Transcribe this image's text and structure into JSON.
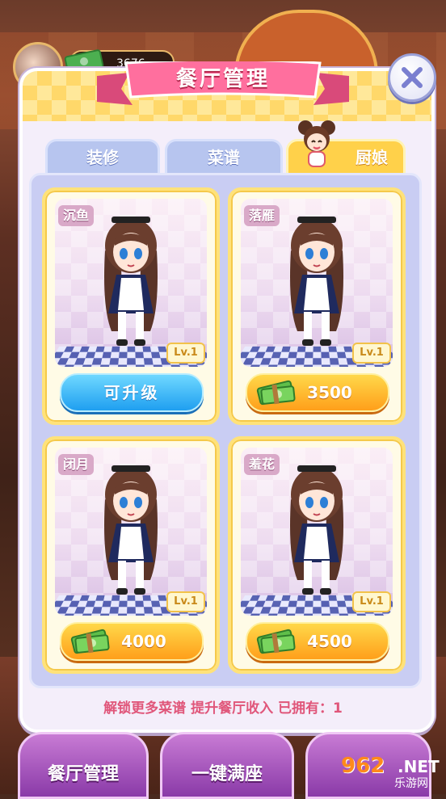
{
  "top_bar": {
    "money": "3676"
  },
  "modal": {
    "title": "餐厅管理"
  },
  "tabs": [
    {
      "label": "装修",
      "active": false
    },
    {
      "label": "菜谱",
      "active": false
    },
    {
      "label": "厨娘",
      "active": true
    }
  ],
  "cards": [
    {
      "name": "沉鱼",
      "level": "Lv.1",
      "button": "可升级",
      "button_type": "upgrade"
    },
    {
      "name": "落雁",
      "level": "Lv.1",
      "button": "3500",
      "button_type": "cost"
    },
    {
      "name": "闭月",
      "level": "Lv.1",
      "button": "4000",
      "button_type": "cost"
    },
    {
      "name": "羞花",
      "level": "Lv.1",
      "button": "4500",
      "button_type": "cost"
    }
  ],
  "footer": {
    "note": "解锁更多菜谱 提升餐厅收入 已拥有：",
    "owned": "1"
  },
  "bottom_bar": [
    {
      "label": "餐厅管理"
    },
    {
      "label": "一键满座"
    }
  ],
  "watermark": {
    "number": "962",
    "net": ".NET",
    "sub": "乐游网"
  },
  "colors": {
    "accent_pink": "#e0567a",
    "gold": "#ffd14a",
    "blue_button": "#1f9ff0"
  },
  "icons": [
    "close-icon",
    "cash-icon",
    "chef-girl-icon"
  ]
}
